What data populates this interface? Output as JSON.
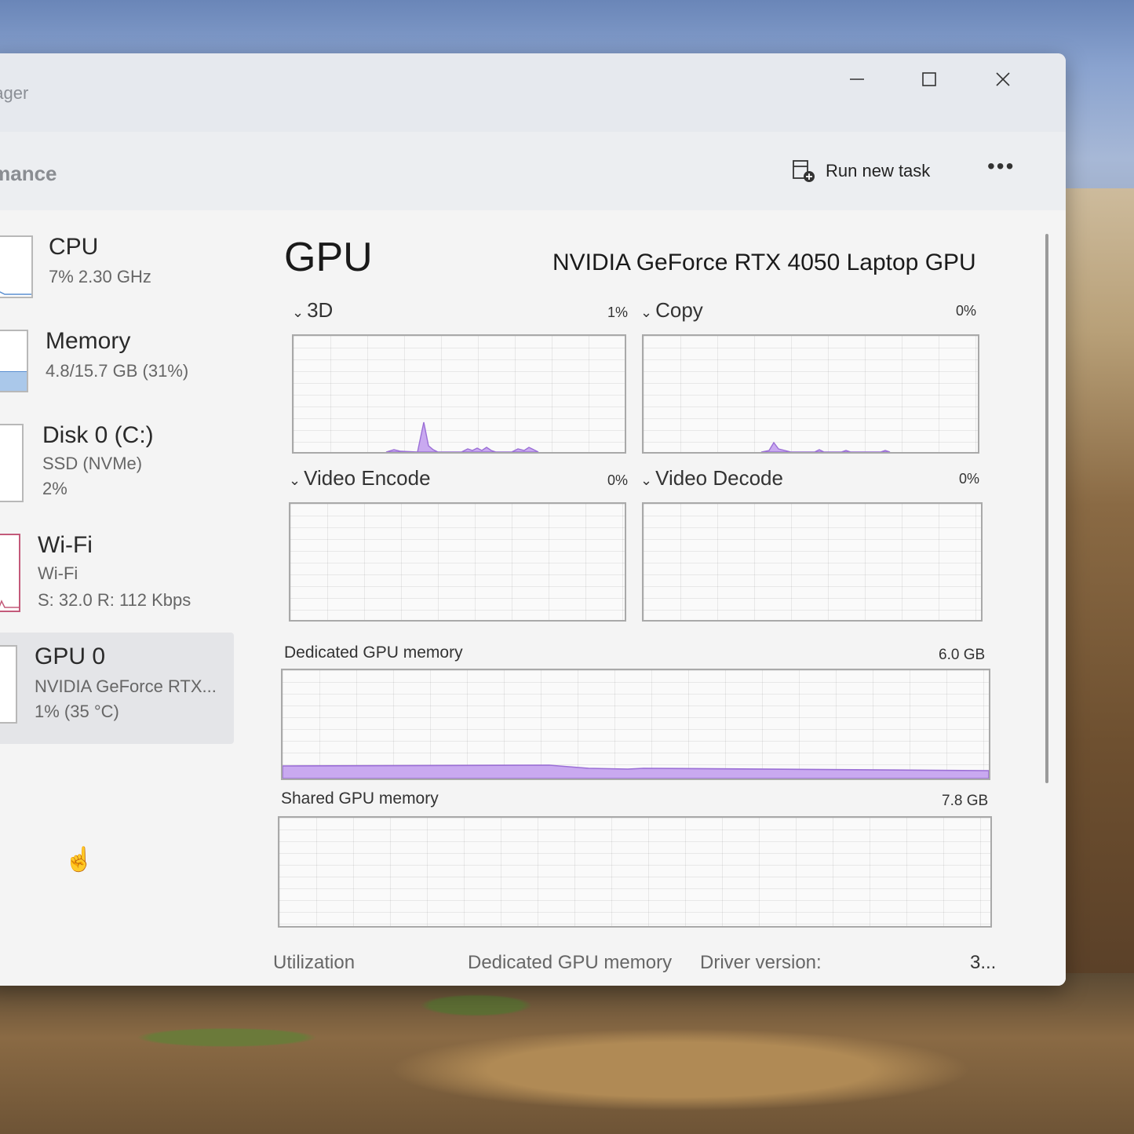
{
  "window": {
    "title": "nager",
    "section": "rmance",
    "run_new_task": "Run new task",
    "more": "•••"
  },
  "sidebar": {
    "items": [
      {
        "name": "CPU",
        "line1": "7%  2.30 GHz",
        "line2": ""
      },
      {
        "name": "Memory",
        "line1": "4.8/15.7 GB (31%)",
        "line2": ""
      },
      {
        "name": "Disk 0 (C:)",
        "line1": "SSD (NVMe)",
        "line2": "2%"
      },
      {
        "name": "Wi-Fi",
        "line1": "Wi-Fi",
        "line2": "S: 32.0  R: 112 Kbps"
      },
      {
        "name": "GPU 0",
        "line1": "NVIDIA GeForce RTX...",
        "line2": "1%  (35 °C)"
      }
    ]
  },
  "main": {
    "title": "GPU",
    "model": "NVIDIA GeForce RTX 4050 Laptop GPU",
    "engines": [
      {
        "label": "3D",
        "pct": "1%"
      },
      {
        "label": "Copy",
        "pct": "0%"
      },
      {
        "label": "Video Encode",
        "pct": "0%"
      },
      {
        "label": "Video Decode",
        "pct": "0%"
      }
    ],
    "dedicated": {
      "label": "Dedicated GPU memory",
      "cap": "6.0 GB"
    },
    "shared": {
      "label": "Shared GPU memory",
      "cap": "7.8 GB"
    },
    "footer": {
      "utilization": "Utilization",
      "dedicated": "Dedicated GPU memory",
      "driver": "Driver version:",
      "driver_value": "3..."
    }
  },
  "colors": {
    "accent": "#9b6fd6",
    "accent_fill": "#c9a9f0"
  }
}
